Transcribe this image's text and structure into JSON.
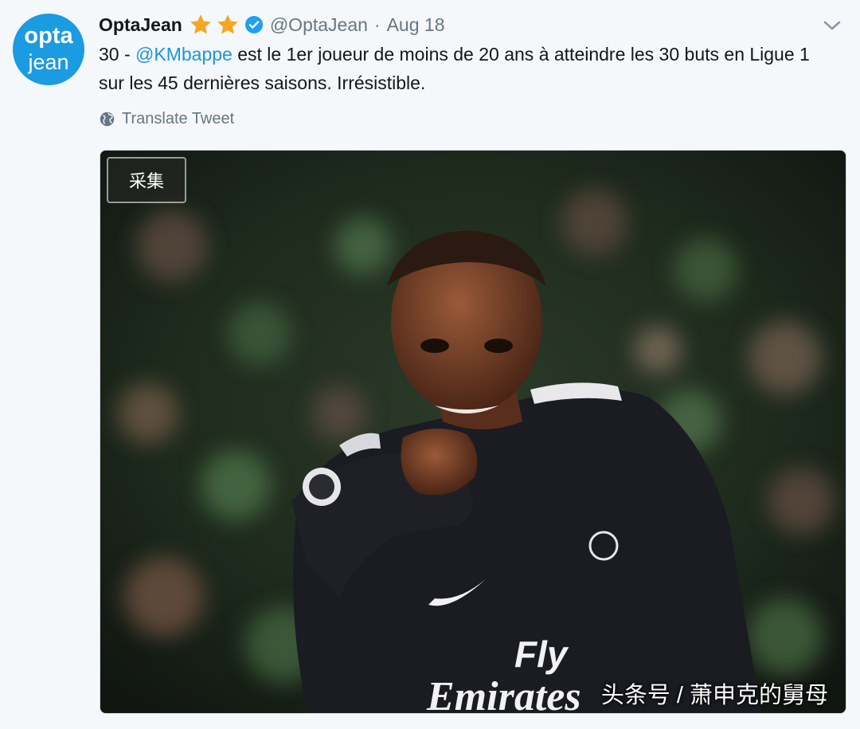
{
  "tweet": {
    "avatar": {
      "line1": "opta",
      "line2": "jean",
      "color": "#1b9be2"
    },
    "display_name": "OptaJean",
    "handle": "@OptaJean",
    "separator": "·",
    "date": "Aug 18",
    "text_before": "30 - ",
    "mention": "@KMbappe",
    "text_after": " est le 1er joueur de moins de 20 ans à atteindre les 30 buts en Ligue 1 sur les 45 dernières saisons. Irrésistible.",
    "translate_label": "Translate Tweet",
    "icons": {
      "stars": "star-icon",
      "verified": "verified-badge-icon",
      "menu": "chevron-down-icon",
      "globe": "globe-icon"
    }
  },
  "photo": {
    "collect_button": "采集",
    "sponsor_text_line1": "Fly",
    "sponsor_text_line2": "Emirates",
    "watermark": "头条号 / 萧申克的舅母"
  },
  "colors": {
    "accent": "#1b95e0",
    "star": "#f5a623",
    "verified": "#1da1f2",
    "muted": "#657786"
  }
}
